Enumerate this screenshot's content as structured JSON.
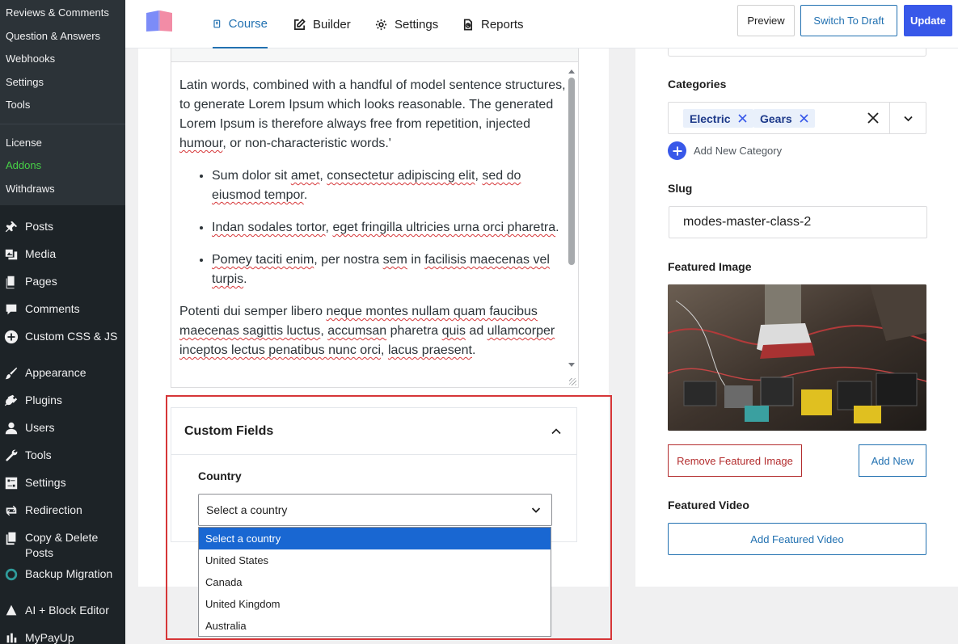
{
  "sidebar": {
    "sub_items": [
      {
        "label": "Reviews & Comments"
      },
      {
        "label": "Question & Answers"
      },
      {
        "label": "Webhooks"
      },
      {
        "label": "Settings"
      },
      {
        "label": "Tools"
      },
      {
        "label": "License"
      },
      {
        "label": "Addons"
      },
      {
        "label": "Withdraws"
      }
    ],
    "menu_items": [
      {
        "label": "Posts",
        "icon": "pin-icon"
      },
      {
        "label": "Media",
        "icon": "media-icon"
      },
      {
        "label": "Pages",
        "icon": "pages-icon"
      },
      {
        "label": "Comments",
        "icon": "comment-icon"
      },
      {
        "label": "Custom CSS & JS",
        "icon": "plus-circle-icon"
      },
      {
        "label": "Appearance",
        "icon": "brush-icon"
      },
      {
        "label": "Plugins",
        "icon": "plug-icon"
      },
      {
        "label": "Users",
        "icon": "user-icon"
      },
      {
        "label": "Tools",
        "icon": "wrench-icon"
      },
      {
        "label": "Settings",
        "icon": "settings-icon"
      },
      {
        "label": "Redirection",
        "icon": "redirect-icon"
      },
      {
        "label": "Copy & Delete Posts",
        "icon": "copy-icon"
      },
      {
        "label": "Backup Migration",
        "icon": "backup-icon"
      },
      {
        "label": "AI + Block Editor",
        "icon": "ai-icon"
      },
      {
        "label": "MyPayUp",
        "icon": "payup-icon"
      }
    ]
  },
  "topbar": {
    "tabs": [
      {
        "label": "Course",
        "icon": "course-icon"
      },
      {
        "label": "Builder",
        "icon": "edit-icon"
      },
      {
        "label": "Settings",
        "icon": "gear-icon"
      },
      {
        "label": "Reports",
        "icon": "reports-icon"
      }
    ],
    "preview_label": "Preview",
    "draft_label": "Switch To Draft",
    "update_label": "Update"
  },
  "editor": {
    "paragraph1_parts": [
      "Latin words, combined with a handful of model sentence structures, to generate Lorem Ipsum which looks reasonable. The generated Lorem Ipsum is therefore always free from repetition, injected ",
      "humour",
      ", or non-characteristic words.'"
    ],
    "bullet1": [
      "Sum dolor sit ",
      "amet",
      ", ",
      "consectetur adipiscing elit",
      ", ",
      "sed do eiusmod tempor",
      "."
    ],
    "bullet2": [
      "Indan sodales tortor",
      ", ",
      "eget fringilla ultricies urna orci pharetra",
      "."
    ],
    "bullet3": [
      "Pomey taciti enim",
      ", per nostra ",
      "sem",
      " in ",
      "facilisis maecenas vel turpis",
      "."
    ],
    "paragraph2": [
      "Potenti dui semper libero ",
      "neque montes nullam quam faucibus maecenas sagittis luctus",
      ", ",
      "accumsan",
      " pharetra ",
      "quis",
      " ad ",
      "ullamcorper inceptos lectus penatibus nunc orci",
      ", ",
      "lacus praesent",
      "."
    ]
  },
  "custom_fields": {
    "title": "Custom Fields",
    "country_label": "Country",
    "select_value": "Select a country",
    "options": [
      "Select a country",
      "United States",
      "Canada",
      "United Kingdom",
      "Australia"
    ]
  },
  "right_panel": {
    "categories_label": "Categories",
    "categories": [
      "Electric",
      "Gears"
    ],
    "add_category_label": "Add New Category",
    "slug_label": "Slug",
    "slug_value": "modes-master-class-2",
    "featured_image_label": "Featured Image",
    "remove_image_label": "Remove Featured Image",
    "add_new_label": "Add New",
    "featured_video_label": "Featured Video",
    "add_video_label": "Add Featured Video"
  },
  "colors": {
    "primary": "#2271b1",
    "update_button": "#3858e9",
    "highlight": "#d63638",
    "addons_active": "#47d147",
    "sidebar_bg": "#1d2327"
  }
}
